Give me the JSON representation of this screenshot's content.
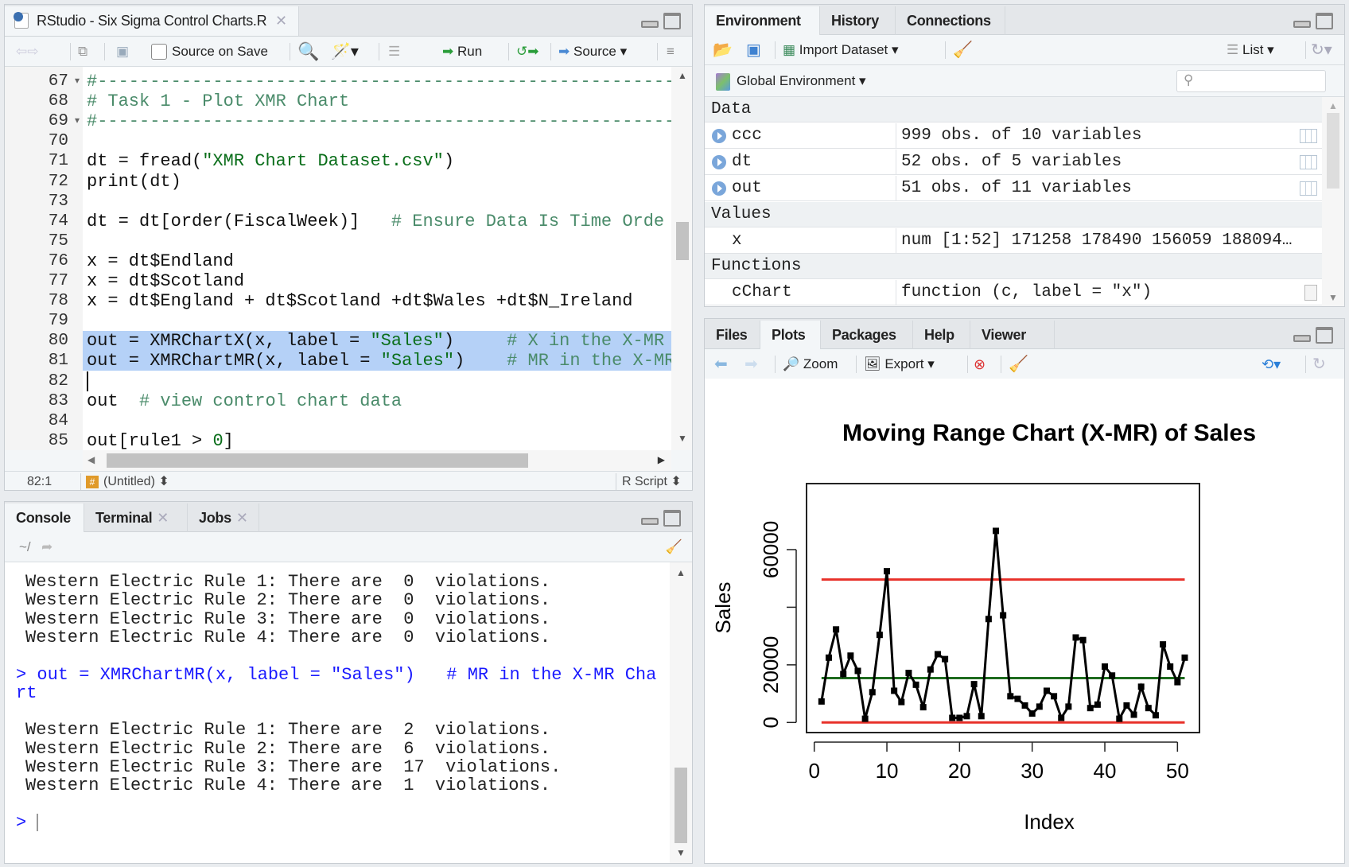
{
  "editor": {
    "tab_title": "RStudio - Six Sigma Control Charts.R",
    "toolbar": {
      "source_on_save": "Source on Save",
      "run": "Run",
      "source": "Source"
    },
    "lines": [
      {
        "n": "67",
        "fold": true,
        "seg": [
          [
            "com",
            "#-----------------------------------------------------------"
          ]
        ]
      },
      {
        "n": "68",
        "seg": [
          [
            "com",
            "# Task 1 - Plot XMR Chart"
          ]
        ]
      },
      {
        "n": "69",
        "fold": true,
        "seg": [
          [
            "com",
            "#-----------------------------------------------------------"
          ]
        ]
      },
      {
        "n": "70",
        "seg": []
      },
      {
        "n": "71",
        "seg": [
          [
            "code",
            "dt = fread("
          ],
          [
            "str",
            "\"XMR Chart Dataset.csv\""
          ],
          [
            "code",
            ")"
          ]
        ]
      },
      {
        "n": "72",
        "seg": [
          [
            "code",
            "print(dt)"
          ]
        ]
      },
      {
        "n": "73",
        "seg": []
      },
      {
        "n": "74",
        "seg": [
          [
            "code",
            "dt = dt[order(FiscalWeek)]   "
          ],
          [
            "com",
            "# Ensure Data Is Time Orde"
          ]
        ]
      },
      {
        "n": "75",
        "seg": []
      },
      {
        "n": "76",
        "seg": [
          [
            "code",
            "x = dt$Endland"
          ]
        ]
      },
      {
        "n": "77",
        "seg": [
          [
            "code",
            "x = dt$Scotland"
          ]
        ]
      },
      {
        "n": "78",
        "seg": [
          [
            "code",
            "x = dt$England + dt$Scotland +dt$Wales +dt$N_Ireland"
          ]
        ]
      },
      {
        "n": "79",
        "seg": []
      },
      {
        "n": "80",
        "selected": true,
        "seg": [
          [
            "code",
            "out = XMRChartX(x, label = "
          ],
          [
            "str",
            "\"Sales\""
          ],
          [
            "code",
            ")     "
          ],
          [
            "com",
            "# X in the X-MR"
          ]
        ]
      },
      {
        "n": "81",
        "selected": true,
        "seg": [
          [
            "code",
            "out = XMRChartMR(x, label = "
          ],
          [
            "str",
            "\"Sales\""
          ],
          [
            "code",
            ")    "
          ],
          [
            "com",
            "# MR in the X-MR"
          ]
        ]
      },
      {
        "n": "82",
        "seg": []
      },
      {
        "n": "83",
        "seg": [
          [
            "code",
            "out  "
          ],
          [
            "com",
            "# view control chart data"
          ]
        ]
      },
      {
        "n": "84",
        "seg": []
      },
      {
        "n": "85",
        "seg": [
          [
            "code",
            "out[rule1 > "
          ],
          [
            "num",
            "0"
          ],
          [
            "code",
            "]"
          ]
        ]
      },
      {
        "n": "86",
        "seg": []
      }
    ],
    "status": {
      "position": "82:1",
      "scope": "(Untitled)",
      "filetype": "R Script"
    }
  },
  "console": {
    "tabs": [
      "Console",
      "Terminal",
      "Jobs"
    ],
    "path": "~/",
    "output": [
      {
        "type": "out",
        "text": "Western Electric Rule 1: There are  0  violations."
      },
      {
        "type": "out",
        "text": "Western Electric Rule 2: There are  0  violations."
      },
      {
        "type": "out",
        "text": "Western Electric Rule 3: There are  0  violations."
      },
      {
        "type": "out",
        "text": "Western Electric Rule 4: There are  0  violations."
      },
      {
        "type": "blank",
        "text": ""
      },
      {
        "type": "cmd",
        "text": "> out = XMRChartMR(x, label = \"Sales\")   # MR in the X-MR Cha"
      },
      {
        "type": "cmd",
        "text": "rt"
      },
      {
        "type": "blank",
        "text": ""
      },
      {
        "type": "out",
        "text": "Western Electric Rule 1: There are  2  violations."
      },
      {
        "type": "out",
        "text": "Western Electric Rule 2: There are  6  violations."
      },
      {
        "type": "out",
        "text": "Western Electric Rule 3: There are  17  violations."
      },
      {
        "type": "out",
        "text": "Western Electric Rule 4: There are  1  violations."
      },
      {
        "type": "blank",
        "text": ""
      },
      {
        "type": "prompt",
        "text": "> "
      }
    ]
  },
  "environment": {
    "tabs": [
      "Environment",
      "History",
      "Connections"
    ],
    "toolbar": {
      "import": "Import Dataset",
      "view": "List"
    },
    "scope": "Global Environment",
    "search_placeholder": "",
    "sections": {
      "data": "Data",
      "values": "Values",
      "functions": "Functions"
    },
    "data": [
      {
        "name": "ccc",
        "value": "999 obs. of 10 variables"
      },
      {
        "name": "dt",
        "value": "52 obs. of 5 variables"
      },
      {
        "name": "out",
        "value": "51 obs. of 11 variables"
      }
    ],
    "values": [
      {
        "name": "x",
        "value": "num [1:52] 171258 178490 156059 188094…"
      }
    ],
    "functions": [
      {
        "name": "cChart",
        "value": "function (c, label = \"x\")"
      }
    ]
  },
  "plots": {
    "tabs": [
      "Files",
      "Plots",
      "Packages",
      "Help",
      "Viewer"
    ],
    "active_tab": "Plots",
    "toolbar": {
      "zoom": "Zoom",
      "export": "Export"
    }
  },
  "chart_data": {
    "type": "line",
    "title": "Moving Range Chart (X-MR) of Sales",
    "xlabel": "Index",
    "ylabel": "Sales",
    "xlim": [
      0,
      52
    ],
    "ylim": [
      0,
      70000
    ],
    "x_ticks": [
      0,
      10,
      20,
      30,
      40,
      50
    ],
    "x_tick_labels": [
      "0",
      "10",
      "20",
      "30",
      "40",
      "50"
    ],
    "y_ticks": [
      0,
      20000,
      40000,
      60000
    ],
    "y_tick_labels": [
      "0",
      "20000",
      "",
      "60000"
    ],
    "x": [
      1,
      2,
      3,
      4,
      5,
      6,
      7,
      8,
      9,
      10,
      11,
      12,
      13,
      14,
      15,
      16,
      17,
      18,
      19,
      20,
      21,
      22,
      23,
      24,
      25,
      26,
      27,
      28,
      29,
      30,
      31,
      32,
      33,
      34,
      35,
      36,
      37,
      38,
      39,
      40,
      41,
      42,
      43,
      44,
      45,
      46,
      47,
      48,
      49,
      50,
      51
    ],
    "values": [
      7300,
      22500,
      32300,
      16800,
      23200,
      17900,
      1300,
      10500,
      30400,
      52500,
      11000,
      7100,
      17200,
      13100,
      5300,
      18400,
      23700,
      22000,
      1600,
      1600,
      2200,
      13300,
      2200,
      35900,
      66500,
      37200,
      9100,
      8200,
      5900,
      3100,
      5500,
      11000,
      9100,
      1600,
      5500,
      29500,
      28600,
      5000,
      6200,
      19400,
      16300,
      1300,
      5900,
      2700,
      12400,
      5000,
      2500,
      27100,
      19400,
      14000,
      22500
    ],
    "control_lines": [
      {
        "value": 49600,
        "color": "#e8312a"
      },
      {
        "value": 15400,
        "color": "#1e6b1e"
      },
      {
        "value": 0,
        "color": "#e8312a"
      }
    ],
    "series_color": "#000000",
    "grid": false
  },
  "colors": {
    "selection": "#b5d1f7",
    "console_command": "#1a1aff",
    "comment": "#4a8b6a"
  }
}
